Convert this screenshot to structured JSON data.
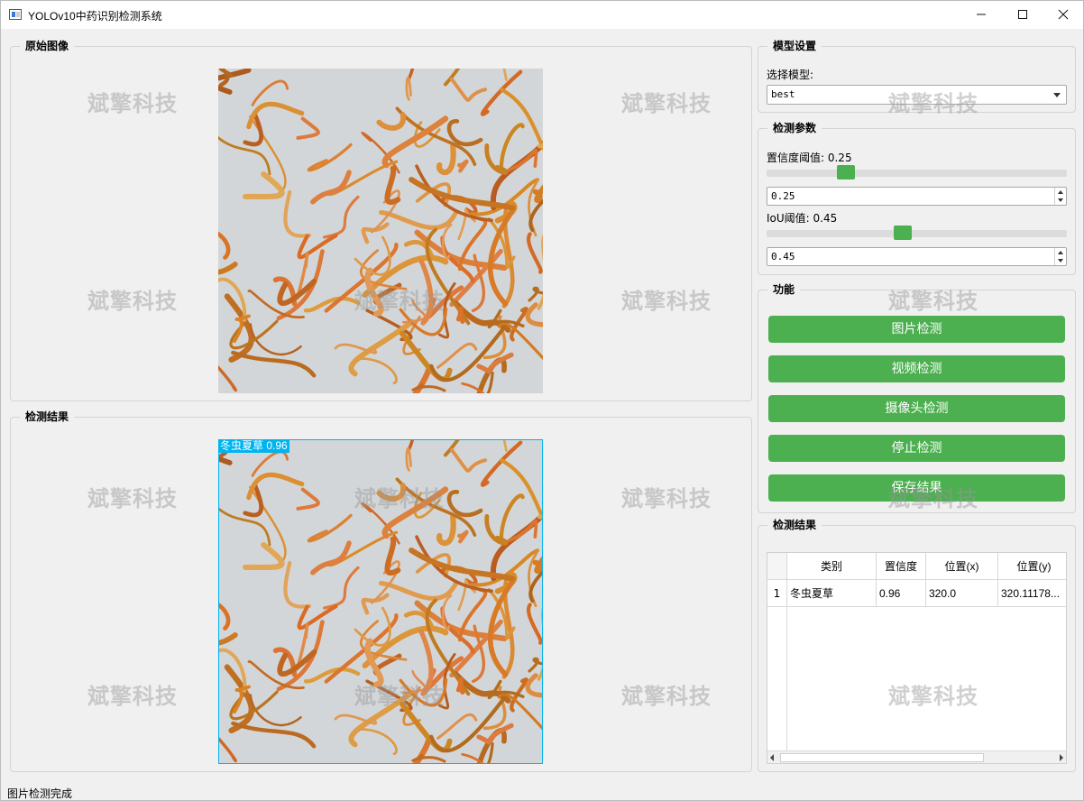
{
  "window": {
    "title": "YOLOv10中药识别检测系统",
    "watermark": "斌擎科技"
  },
  "left": {
    "original_title": "原始图像",
    "result_title": "检测结果",
    "detection_label": "冬虫夏草 0.96",
    "box_color": "#00b4f0"
  },
  "model": {
    "group_title": "模型设置",
    "select_label": "选择模型:",
    "selected": "best"
  },
  "params": {
    "group_title": "检测参数",
    "conf_label": "置信度阈值: 0.25",
    "conf_value": "0.25",
    "conf_fraction": 0.25,
    "iou_label": "IoU阈值: 0.45",
    "iou_value": "0.45",
    "iou_fraction": 0.45
  },
  "functions": {
    "group_title": "功能",
    "image_btn": "图片检测",
    "video_btn": "视频检测",
    "camera_btn": "摄像头检测",
    "stop_btn": "停止检测",
    "save_btn": "保存结果",
    "accent": "#4caf50"
  },
  "results": {
    "group_title": "检测结果",
    "columns": [
      "类别",
      "置信度",
      "位置(x)",
      "位置(y)"
    ],
    "rows": [
      {
        "index": "1",
        "cells": [
          "冬虫夏草",
          "0.96",
          "320.0",
          "320.11178..."
        ]
      }
    ]
  },
  "status": {
    "text": "图片检测完成"
  }
}
